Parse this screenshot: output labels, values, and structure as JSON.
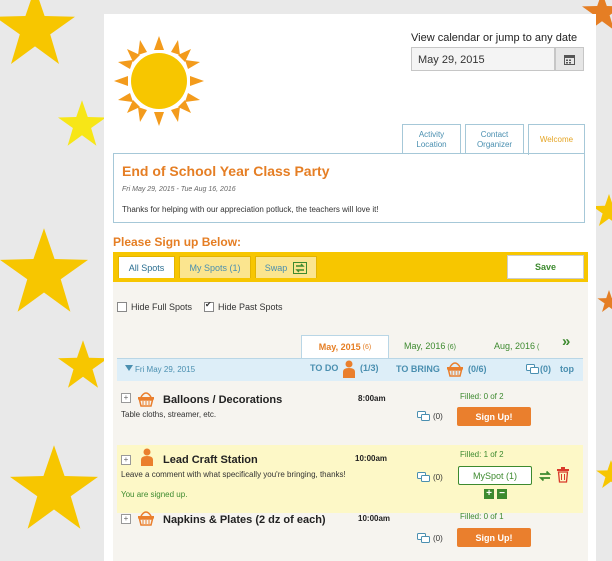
{
  "date_picker": {
    "label": "View calendar or jump to any date",
    "value": "May 29, 2015"
  },
  "top_tabs": [
    {
      "line1": "Activity",
      "line2": "Location"
    },
    {
      "line1": "Contact",
      "line2": "Organizer"
    },
    {
      "label": "Welcome"
    }
  ],
  "event": {
    "title": "End of School Year Class Party",
    "dates": "Fri May 29, 2015 - Tue Aug 16, 2016",
    "description": "Thanks for helping with our appreciation potluck, the teachers will love it!"
  },
  "signup_heading": "Please Sign up Below:",
  "tabs": {
    "all": "All Spots",
    "my": "My Spots (1)",
    "swap": "Swap",
    "save": "Save"
  },
  "filters": {
    "hide_full": "Hide Full Spots",
    "hide_full_checked": false,
    "hide_past": "Hide Past Spots",
    "hide_past_checked": true
  },
  "date_tabs": [
    {
      "label": "May, 2015",
      "count": "(6)",
      "active": true
    },
    {
      "label": "May, 2016",
      "count": "(6)",
      "active": false
    },
    {
      "label": "Aug, 2016",
      "count": "(",
      "active": false
    }
  ],
  "next_arrow": "»",
  "day_header": {
    "date": "Fri May 29, 2015",
    "todo_label": "TO DO",
    "todo_count": "(1/3)",
    "bring_label": "TO BRING",
    "bring_count": "(0/6)",
    "comment_count": "(0)",
    "top_link": "top"
  },
  "items": [
    {
      "name": "Balloons / Decorations",
      "desc": "Table cloths, streamer, etc.",
      "time": "8:00am",
      "comments": "(0)",
      "filled": "Filled: 0 of 2",
      "button": "Sign Up!",
      "type": "bring"
    },
    {
      "name": "Lead Craft Station",
      "desc": "Leave a comment with what specifically you're bringing, thanks!",
      "time": "10:00am",
      "comments": "(0)",
      "filled": "Filled: 1 of 2",
      "button": "MySpot (1)",
      "signed": "You are signed up.",
      "type": "todo"
    },
    {
      "name": "Napkins & Plates (2 dz of each)",
      "desc": "",
      "time": "10:00am",
      "comments": "(0)",
      "filled": "Filled: 0 of 1",
      "button": "Sign Up!",
      "type": "bring"
    }
  ],
  "colors": {
    "accent": "#e57e24",
    "tabbar": "#f7c600",
    "green": "#3d8a2f",
    "blue": "#4a8fb0",
    "signed_bg": "#fdf8c7"
  }
}
